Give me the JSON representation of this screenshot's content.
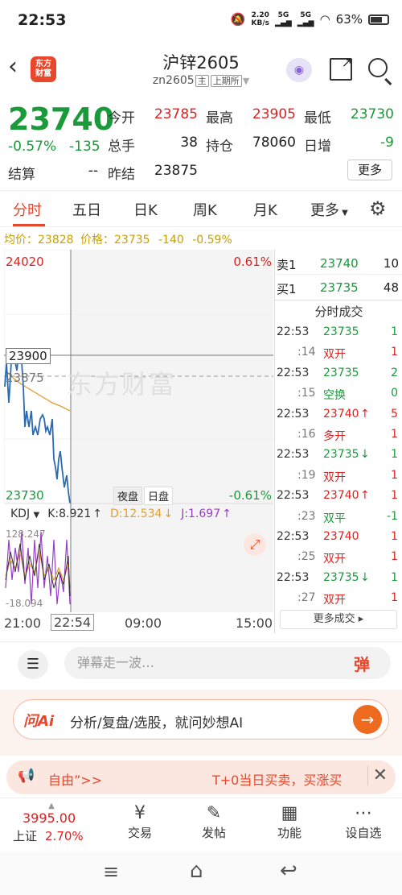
{
  "status": {
    "time": "22:53",
    "net_speed_top": "2.20",
    "net_speed_bottom": "KB/s",
    "sig1": "5G",
    "sig2": "5G",
    "battery": "63%"
  },
  "header": {
    "logo_line1": "东方",
    "logo_line2": "财富",
    "title": "沪锌2605",
    "code": "zn2605",
    "tag1": "主",
    "tag2": "上期所"
  },
  "quote": {
    "price": "23740",
    "change_pct": "-0.57%",
    "change": "-135",
    "open_label": "今开",
    "open": "23785",
    "high_label": "最高",
    "high": "23905",
    "low_label": "最低",
    "low": "23730",
    "volume_label": "总手",
    "volume": "38",
    "oi_label": "持仓",
    "oi": "78060",
    "daily_inc_label": "日增",
    "daily_inc": "-9",
    "settle_label": "结算",
    "settle": "--",
    "prev_settle_label": "昨结",
    "prev_settle": "23875",
    "more_button": "更多"
  },
  "tabs": [
    "分时",
    "五日",
    "日K",
    "周K",
    "月K",
    "更多"
  ],
  "avg": {
    "avg_label": "均价：",
    "avg": "23828",
    "price_label": "价格：",
    "price": "23735",
    "chg": "-140",
    "pct": "-0.59%"
  },
  "chart": {
    "top_price": "24020",
    "top_pct": "0.61%",
    "cross_price": "23900",
    "ref_price": "23875",
    "bottom_price": "23730",
    "bottom_pct": "-0.61%",
    "watermark": "东方财富",
    "night_btn": "夜盘",
    "day_btn": "日盘",
    "kdj_label": "KDJ",
    "k_val": "K:8.921",
    "d_val": "D:12.534",
    "j_val": "J:1.697",
    "kdj_top": "128.247",
    "kdj_bottom": "-18.094"
  },
  "time_axis": [
    "21:00",
    "22:54",
    "09:00",
    "15:00"
  ],
  "book": {
    "ask_label": "卖1",
    "ask_price": "23740",
    "ask_vol": "10",
    "bid_label": "买1",
    "bid_price": "23735",
    "bid_vol": "48",
    "trades_title": "分时成交",
    "trades": [
      {
        "time": "22:53",
        "price": "23735",
        "arrow": "",
        "vol": "1",
        "color": "green"
      },
      {
        "time": ":14",
        "price": "双开",
        "arrow": "",
        "vol": "1",
        "color": "red"
      },
      {
        "time": "22:53",
        "price": "23735",
        "arrow": "",
        "vol": "2",
        "color": "green"
      },
      {
        "time": ":15",
        "price": "空换",
        "arrow": "",
        "vol": "0",
        "color": "green"
      },
      {
        "time": "22:53",
        "price": "23740",
        "arrow": "↑",
        "vol": "5",
        "color": "red"
      },
      {
        "time": ":16",
        "price": "多开",
        "arrow": "",
        "vol": "1",
        "color": "red"
      },
      {
        "time": "22:53",
        "price": "23735",
        "arrow": "↓",
        "vol": "1",
        "color": "green"
      },
      {
        "time": ":19",
        "price": "双开",
        "arrow": "",
        "vol": "1",
        "color": "red"
      },
      {
        "time": "22:53",
        "price": "23740",
        "arrow": "↑",
        "vol": "1",
        "color": "red"
      },
      {
        "time": ":23",
        "price": "双平",
        "arrow": "",
        "vol": "-1",
        "color": "green"
      },
      {
        "time": "22:53",
        "price": "23740",
        "arrow": "",
        "vol": "1",
        "color": "red"
      },
      {
        "time": ":25",
        "price": "双开",
        "arrow": "",
        "vol": "1",
        "color": "red"
      },
      {
        "time": "22:53",
        "price": "23735",
        "arrow": "↓",
        "vol": "1",
        "color": "green"
      },
      {
        "time": ":27",
        "price": "双开",
        "arrow": "",
        "vol": "1",
        "color": "red"
      }
    ],
    "more_trades": "更多成交"
  },
  "danmu": {
    "placeholder": "弹幕走一波…",
    "btn": "弹"
  },
  "ai": {
    "logo": "问Ai",
    "text": "分析/复盘/选股，就问妙想AI"
  },
  "promo": {
    "text_left": "自由”>>",
    "text_right": "T+0当日买卖，买涨买"
  },
  "bottom_nav": {
    "index_price": "3995.00",
    "index_name": "上证",
    "index_pct": "2.70%",
    "items": [
      "交易",
      "发帖",
      "功能",
      "设自选"
    ]
  },
  "colors": {
    "up": "#e02020",
    "down": "#1a9a3a",
    "accent": "#e8472b"
  }
}
